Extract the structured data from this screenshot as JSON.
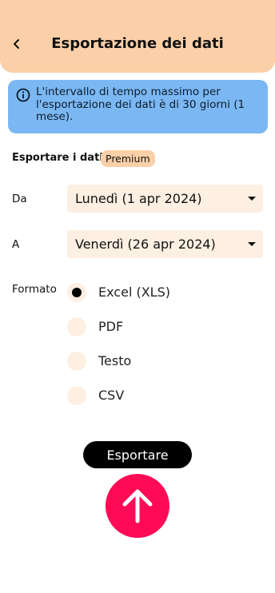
{
  "header": {
    "title": "Esportazione dei dati",
    "back_icon": "chevron-left-icon"
  },
  "info": {
    "icon": "info-icon",
    "text": "L'intervallo di tempo massimo per l'esportazione dei dati è di 30 giorni (1 mese)."
  },
  "export_section": {
    "title": "Esportare i dati",
    "badge": "Premium"
  },
  "from": {
    "label": "Da",
    "value": "Lunedì (1 apr 2024)"
  },
  "to": {
    "label": "A",
    "value": "Venerdì (26 apr 2024)"
  },
  "format": {
    "label": "Formato",
    "selected": "Excel (XLS)",
    "options": [
      {
        "label": "Excel (XLS)",
        "checked": true
      },
      {
        "label": "PDF",
        "checked": false
      },
      {
        "label": "Testo",
        "checked": false
      },
      {
        "label": "CSV",
        "checked": false
      }
    ]
  },
  "actions": {
    "export_label": "Esportare",
    "fab_icon": "arrow-up-icon"
  },
  "colors": {
    "header_bg": "#fbd0a8",
    "info_bg": "#7bb8f3",
    "field_bg": "#fdefe2",
    "accent": "#ff0a55",
    "button_bg": "#000000"
  }
}
